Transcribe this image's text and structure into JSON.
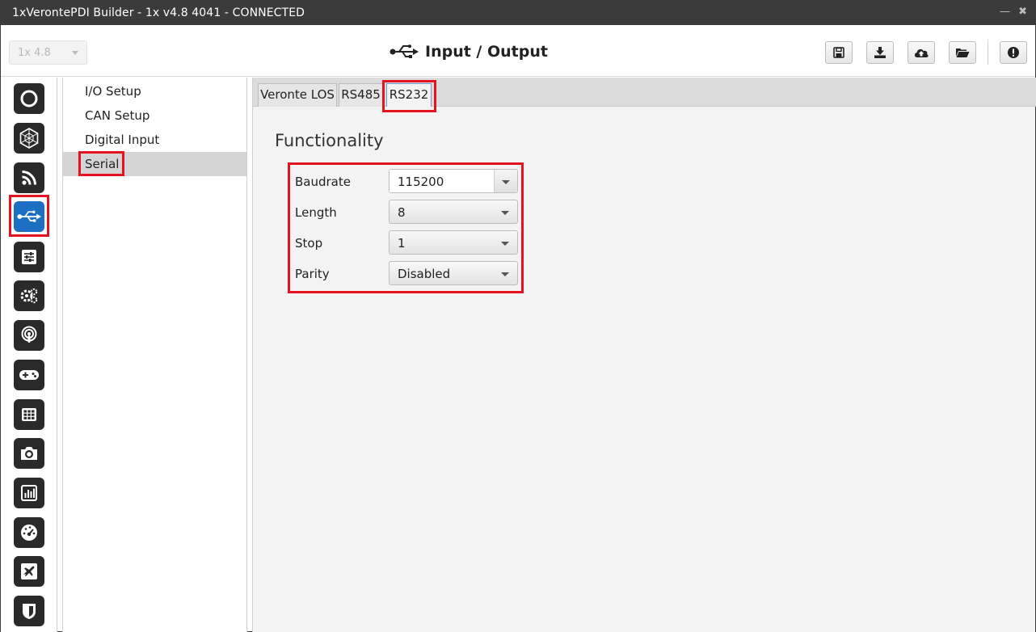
{
  "window": {
    "title": "1xVerontePDI Builder - 1x v4.8 4041 - CONNECTED",
    "controls": {
      "minimize": "—",
      "close": "✖"
    }
  },
  "header": {
    "version_select": {
      "value": "1x 4.8"
    },
    "page_title": "Input / Output",
    "toolbar": [
      "save-icon",
      "download-icon",
      "cloud-upload-icon",
      "folder-open-icon",
      "alert-icon"
    ]
  },
  "sidebar": {
    "icons": [
      "power-icon",
      "hexagon-icon",
      "rss-icon",
      "usb-icon",
      "sliders-icon",
      "gears-icon",
      "podcast-icon",
      "gamepad-icon",
      "grid-icon",
      "camera-icon",
      "bar-chart-icon",
      "gauge-icon",
      "plane-icon",
      "shield-icon"
    ],
    "active": "usb-icon"
  },
  "submenu": {
    "items": [
      {
        "label": "I/O Setup"
      },
      {
        "label": "CAN Setup"
      },
      {
        "label": "Digital Input"
      },
      {
        "label": "Serial"
      }
    ],
    "selected": "Serial"
  },
  "tabs": [
    {
      "label": "Veronte LOS"
    },
    {
      "label": "RS485"
    },
    {
      "label": "RS232"
    }
  ],
  "selected_tab": "RS232",
  "functionality": {
    "title": "Functionality",
    "fields": [
      {
        "label": "Baudrate",
        "value": "115200"
      },
      {
        "label": "Length",
        "value": "8"
      },
      {
        "label": "Stop",
        "value": "1"
      },
      {
        "label": "Parity",
        "value": "Disabled"
      }
    ]
  },
  "colors": {
    "accent": "#1d6fc2",
    "highlight": "#e3141f",
    "titlebar": "#3b3b3b"
  }
}
